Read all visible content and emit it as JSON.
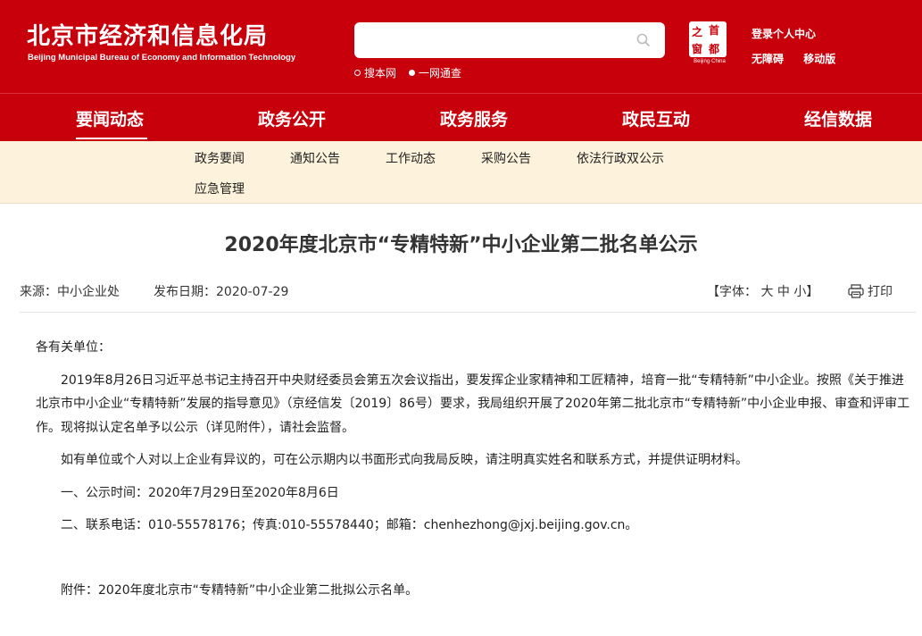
{
  "header": {
    "logo_cn": "北京市经济和信息化局",
    "logo_en": "Beijing Municipal Bureau of Economy and Information Technology",
    "search": {
      "placeholder": "",
      "options": [
        "搜本网",
        "一网通查"
      ]
    },
    "capital_logo": {
      "chars": [
        "之",
        "首",
        "窗",
        "都"
      ],
      "subtitle": "Beijing·China"
    },
    "links": {
      "login": "登录个人中心",
      "accessibility": "无障碍",
      "mobile": "移动版"
    }
  },
  "nav": {
    "items": [
      "要闻动态",
      "政务公开",
      "政务服务",
      "政民互动",
      "经信数据"
    ],
    "active_index": 0
  },
  "subnav": {
    "items": [
      "政务要闻",
      "通知公告",
      "工作动态",
      "采购公告",
      "依法行政双公示",
      "应急管理"
    ]
  },
  "article": {
    "title": "2020年度北京市“专精特新”中小企业第二批名单公示",
    "source_label": "来源：",
    "source": "中小企业处",
    "date_label": "发布日期：",
    "date": "2020-07-29",
    "font_size_label": "【字体：",
    "font_sizes": [
      "大",
      "中",
      "小"
    ],
    "font_size_close": "】",
    "print_label": "打印",
    "salutation": "各有关单位：",
    "paragraphs": [
      "2019年8月26日习近平总书记主持召开中央财经委员会第五次会议指出，要发挥企业家精神和工匠精神，培育一批“专精特新”中小企业。按照《关于推进北京市中小企业“专精特新”发展的指导意见》（京经信发〔2019〕86号）要求，我局组织开展了2020年第二批北京市“专精特新”中小企业申报、审查和评审工作。现将拟认定名单予以公示（详见附件），请社会监督。",
      "如有单位或个人对以上企业有异议的，可在公示期内以书面形式向我局反映，请注明真实姓名和联系方式，并提供证明材料。",
      "一、公示时间：2020年7月29日至2020年8月6日",
      "二、联系电话：010-55578176；传真:010-55578440；邮箱：chenhezhong@jxj.beijing.gov.cn。"
    ],
    "attachment": "附件：2020年度北京市“专精特新”中小企业第二批拟公示名单。"
  },
  "colors": {
    "brand_red": "#c7000b",
    "subnav_bg": "#fdf3dc"
  }
}
